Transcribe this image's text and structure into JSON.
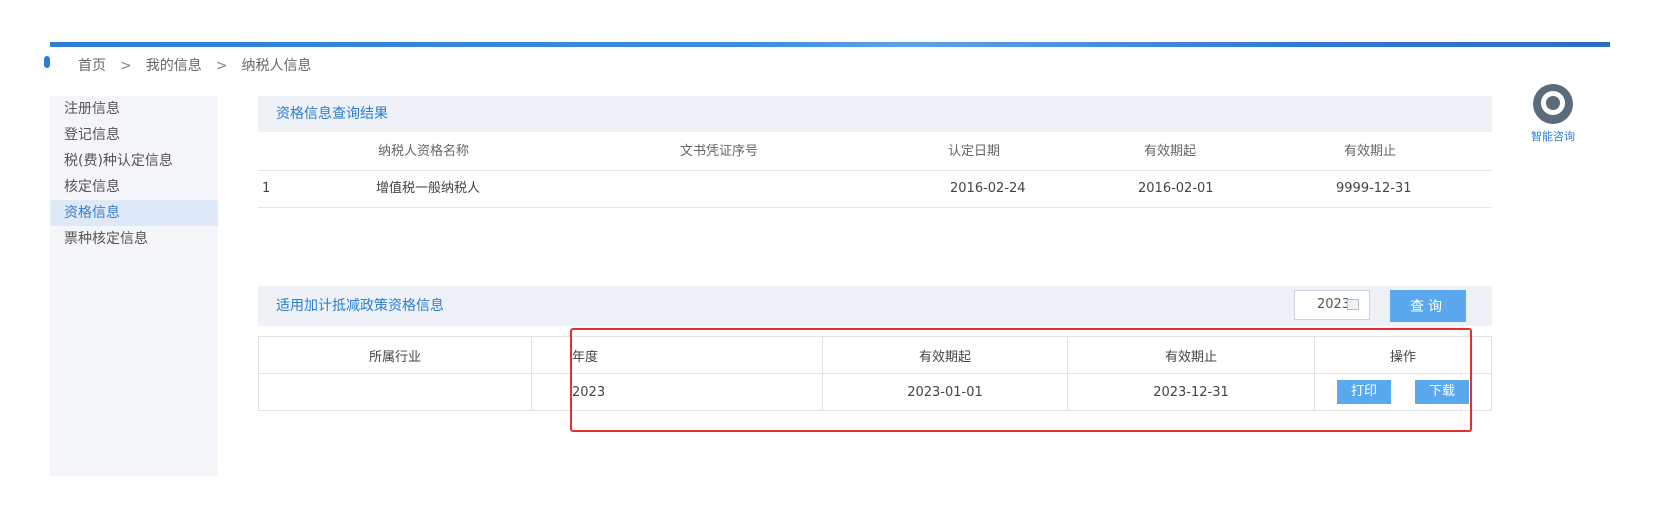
{
  "breadcrumb": {
    "items": [
      "首页",
      "我的信息",
      "纳税人信息"
    ],
    "separator": ">"
  },
  "help": {
    "label": "智能咨询",
    "icon": "headset-icon"
  },
  "sidebar": {
    "items": [
      {
        "label": "注册信息"
      },
      {
        "label": "登记信息"
      },
      {
        "label": "税(费)种认定信息"
      },
      {
        "label": "核定信息"
      },
      {
        "label": "资格信息",
        "active": true
      },
      {
        "label": "票种核定信息"
      }
    ]
  },
  "qualification": {
    "title": "资格信息查询结果",
    "columns": [
      "纳税人资格名称",
      "文书凭证序号",
      "认定日期",
      "有效期起",
      "有效期止"
    ],
    "rows": [
      {
        "index": "1",
        "name": "增值税一般纳税人",
        "doc_no": "",
        "date": "2016-02-24",
        "start": "2016-02-01",
        "end": "9999-12-31"
      }
    ]
  },
  "deduction": {
    "title": "适用加计抵减政策资格信息",
    "year_value": "2023",
    "query_label": "查询",
    "columns": [
      "所属行业",
      "年度",
      "有效期起",
      "有效期止",
      "操作"
    ],
    "rows": [
      {
        "industry": "",
        "year": "2023",
        "start": "2023-01-01",
        "end": "2023-12-31"
      }
    ],
    "print_label": "打印",
    "download_label": "下载"
  },
  "colors": {
    "accent": "#2a7fd4",
    "button": "#5aa8ee",
    "highlight": "#e53030"
  }
}
